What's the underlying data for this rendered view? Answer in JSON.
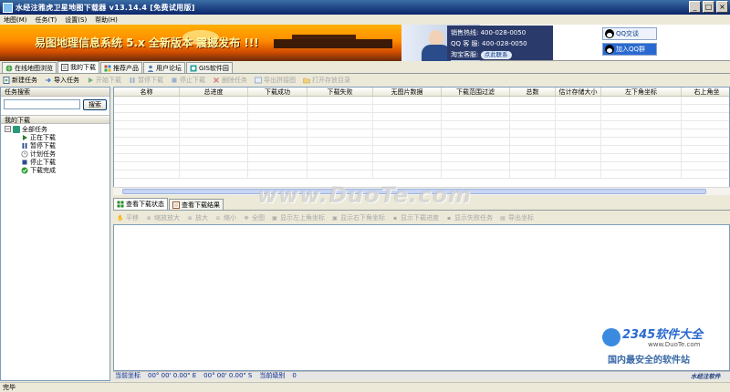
{
  "window": {
    "title": "水经注雅虎卫星地图下载器 v13.14.4 [免费试用版]"
  },
  "menu": [
    "地图(M)",
    "任务(T)",
    "设置(S)",
    "帮助(H)"
  ],
  "banner": {
    "slogan": "易图地理信息系统 5.x 全新版本 震撼发布 !!!",
    "sales_hotline": "销售热线: 400-028-0050",
    "qq_service": "QQ 客 服: 400-028-0050",
    "taobao_service": "淘宝客服:",
    "contact_button": "点此联系",
    "qq_chat": "QQ交谈",
    "qq_join": "加入QQ群"
  },
  "tabs": [
    "在线地图浏览",
    "我的下载",
    "推荐产品",
    "用户论坛",
    "GIS软件园"
  ],
  "toolbar": [
    "新建任务",
    "导入任务",
    "开始下载",
    "暂停下载",
    "停止下载",
    "删除任务",
    "导出拼接图",
    "打开存放目录"
  ],
  "left_panel": {
    "task_search_title": "任务搜索",
    "search_button": "搜索",
    "my_downloads_title": "我的下载",
    "tree_root": "全部任务",
    "tree_items": [
      "正在下载",
      "暂停下载",
      "计划任务",
      "停止下载",
      "下载完成"
    ]
  },
  "table": {
    "columns": [
      "名称",
      "总进度",
      "下载成功",
      "下载失败",
      "无图片数据",
      "下载范围过滤",
      "总数",
      "估计存储大小",
      "左下角坐标",
      "右上角坐"
    ]
  },
  "lower_tabs": [
    "查看下载状态",
    "查看下载结果"
  ],
  "lower_toolbar": [
    "平移",
    "缩放放大",
    "放大",
    "缩小",
    "全图",
    "显示左上角坐标",
    "显示右下角坐标",
    "显示下载进度",
    "显示失败任务",
    "导出坐标"
  ],
  "coord_bar": {
    "label": "当前坐标",
    "lon": "00° 00'  0.00\" E",
    "lat": "00° 00'  0.00\" S",
    "level_label": "当前级别",
    "level": "0"
  },
  "status": "完毕",
  "watermarks": {
    "duote": "www.DuoTe.com",
    "logo_2345": "2345软件大全",
    "site_2345": "www.DuoTe.com",
    "tagline": "国内最安全的软件站",
    "brand_signature": "水经注软件"
  },
  "colors": {
    "titlebar": "#0a246a",
    "banner_orange": "#ff8a00",
    "panel_border": "#7f9db9",
    "coord_text": "#0b2a8a"
  }
}
